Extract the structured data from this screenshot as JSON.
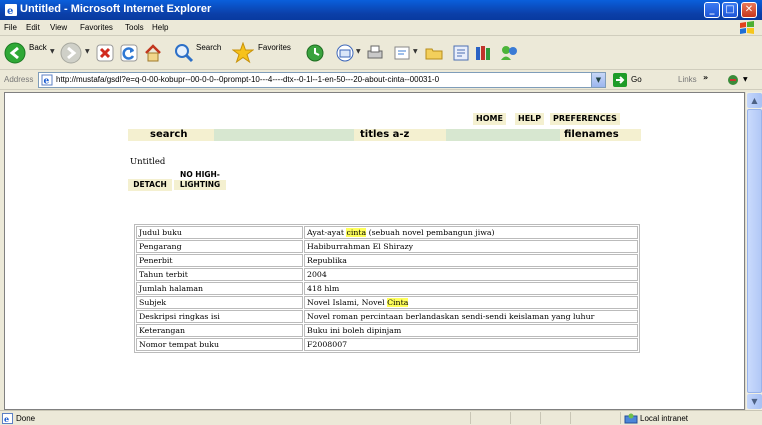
{
  "window": {
    "title": "Untitled - Microsoft Internet Explorer"
  },
  "menu": [
    "File",
    "Edit",
    "View",
    "Favorites",
    "Tools",
    "Help"
  ],
  "toolbar": {
    "back_label": "Back",
    "search_label": "Search",
    "favorites_label": "Favorites"
  },
  "address": {
    "label": "Address",
    "url": "http://mustafa/gsdl?e=q-0-00-kobupr--00-0-0--0prompt-10---4----dtx--0-1l--1-en-50---20-about-cinta--00031-0",
    "go_label": "Go",
    "links_label": "Links"
  },
  "page": {
    "top_links": [
      "HOME",
      "HELP",
      "PREFERENCES"
    ],
    "nav": {
      "search": "search",
      "titles": "titles a-z",
      "filenames": "filenames"
    },
    "doc_title": "Untitled",
    "detach_label": "DETACH",
    "nohigh_line1": "NO HIGH-",
    "nohigh_line2": "LIGHTING",
    "meta_rows": [
      {
        "key": "Judul buku",
        "pre": "Ayat-ayat ",
        "hl": "cinta",
        "post": " (sebuah novel pembangun jiwa)"
      },
      {
        "key": "Pengarang",
        "pre": "Habiburrahman El Shirazy",
        "hl": "",
        "post": ""
      },
      {
        "key": "Penerbit",
        "pre": "Republika",
        "hl": "",
        "post": ""
      },
      {
        "key": "Tahun terbit",
        "pre": "2004",
        "hl": "",
        "post": ""
      },
      {
        "key": "Jumlah halaman",
        "pre": "418 hlm",
        "hl": "",
        "post": ""
      },
      {
        "key": "Subjek",
        "pre": "Novel Islami, Novel ",
        "hl": "Cinta",
        "post": ""
      },
      {
        "key": "Deskripsi ringkas isi",
        "pre": "Novel roman percintaan berlandaskan sendi-sendi keislaman yang luhur",
        "hl": "",
        "post": ""
      },
      {
        "key": "Keterangan",
        "pre": "Buku ini boleh dipinjam",
        "hl": "",
        "post": ""
      },
      {
        "key": "Nomor tempat buku",
        "pre": "F2008007",
        "hl": "",
        "post": ""
      }
    ]
  },
  "status": {
    "text": "Done",
    "zone": "Local intranet"
  },
  "colors": {
    "highlight": "#ffff5a",
    "nav_bg": "#f4f0d0",
    "nav_bar": "#d7e7d0",
    "titlebar": "#0b3fa8"
  }
}
